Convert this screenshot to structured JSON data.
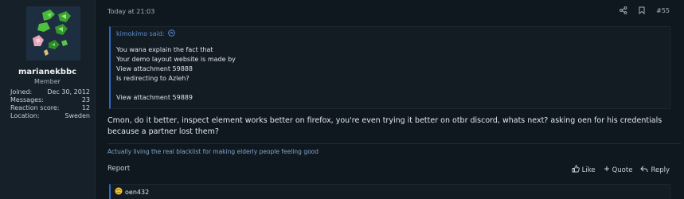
{
  "user": {
    "name": "marianekbbc",
    "role": "Member",
    "stats": [
      {
        "label": "Joined:",
        "value": "Dec 30, 2012"
      },
      {
        "label": "Messages:",
        "value": "23"
      },
      {
        "label": "Reaction score:",
        "value": "12"
      },
      {
        "label": "Location:",
        "value": "Sweden"
      }
    ]
  },
  "post": {
    "date": "Today at 21:03",
    "number": "#55",
    "quote": {
      "header": "kimokimo said:",
      "lines": [
        "You wana explain the fact that",
        "Your demo layout website is made by",
        "View attachment 59888",
        "Is redirecting to Azleh?",
        "",
        "View attachment 59889"
      ]
    },
    "content": "Cmon, do it better, inspect element works better on firefox, you're even trying it better on otbr discord, whats next? asking oen for his credentials because a partner lost them?",
    "signature": "Actually living the real blacklist for making elderly people feeling good",
    "report_label": "Report",
    "like_label": "Like",
    "quote_label": "Quote",
    "reply_label": "Reply",
    "reaction_user": "oen432"
  },
  "icons": [
    "share-icon",
    "bookmark-icon",
    "expand-icon",
    "thumbs-up-icon",
    "plus-icon",
    "reply-icon",
    "reaction-emoji-icon"
  ]
}
